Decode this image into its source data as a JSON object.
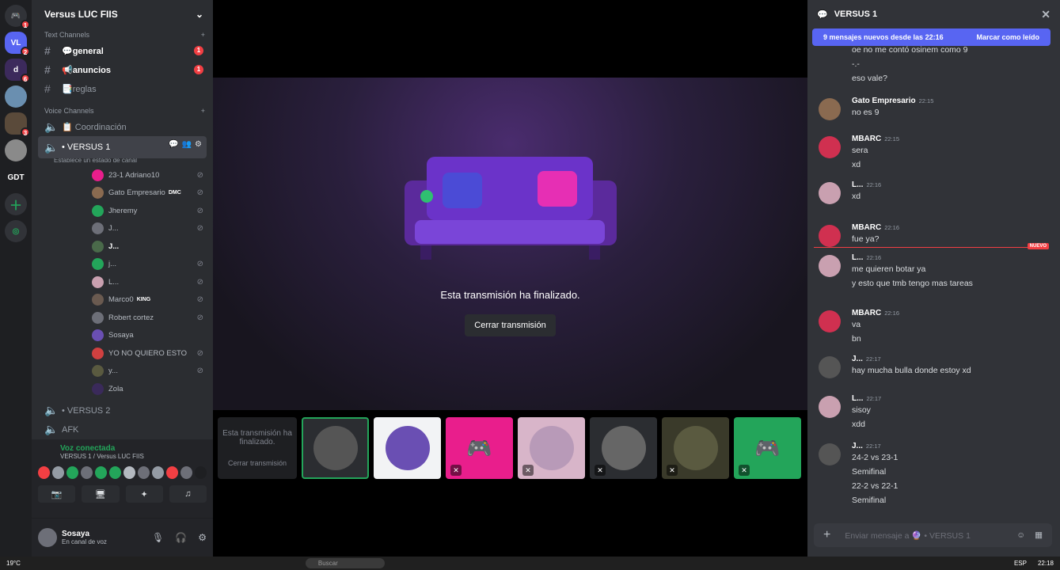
{
  "server": {
    "name": "Versus LUC FIIS"
  },
  "rail": [
    {
      "label": "",
      "badge": "1"
    },
    {
      "label": "VL",
      "badge": "2"
    },
    {
      "label": "d",
      "badge": "6"
    },
    {
      "label": "",
      "badge": ""
    },
    {
      "label": "",
      "badge": "3"
    },
    {
      "label": "",
      "badge": ""
    },
    {
      "label": "GDT",
      "badge": ""
    }
  ],
  "categories": {
    "text": "Text Channels",
    "voice": "Voice Channels"
  },
  "text_channels": [
    {
      "name": "💬general",
      "badge": "1"
    },
    {
      "name": "📢anuncios",
      "badge": "1"
    },
    {
      "name": "📑reglas",
      "badge": ""
    }
  ],
  "voice_channels": {
    "coordinacion": "📋 Coordinación",
    "active": "• VERSUS 1",
    "active_sub": "Establece un estado de canal",
    "v2": "• VERSUS 2",
    "afk": "AFK"
  },
  "voice_users": [
    {
      "name": "23-1 Adriano10",
      "tag": ""
    },
    {
      "name": "Gato Empresario",
      "tag": "DMC"
    },
    {
      "name": "Jheremy",
      "tag": ""
    },
    {
      "name": "J...",
      "tag": ""
    },
    {
      "name": "J...",
      "tag": ""
    },
    {
      "name": "j...",
      "tag": ""
    },
    {
      "name": "L...",
      "tag": ""
    },
    {
      "name": "Marco0",
      "tag": "KING"
    },
    {
      "name": "Robert cortez",
      "tag": ""
    },
    {
      "name": "Sosaya",
      "tag": ""
    },
    {
      "name": "YO NO QUIERO ESTO",
      "tag": ""
    },
    {
      "name": "y...",
      "tag": ""
    },
    {
      "name": "Zola",
      "tag": ""
    }
  ],
  "voice_panel": {
    "status": "Voz conectada",
    "sub": "VERSUS 1 / Versus LUC FIIS"
  },
  "user_panel": {
    "name": "Sosaya",
    "status": "En canal de voz"
  },
  "stream": {
    "ended": "Esta transmisión ha finalizado.",
    "close": "Cerrar transmisión",
    "tile_text": "Esta transmisión ha finalizado.",
    "tile_close": "Cerrar transmisión"
  },
  "chat": {
    "title": "VERSUS 1",
    "new_banner": "9 mensajes nuevos desde las 22:16",
    "mark_read": "Marcar como leído",
    "new_tag": "NUEVO",
    "input_placeholder": "Enviar mensaje a 🔮 • VERSUS 1",
    "top_lines": [
      "oe no me contó osinem como 9",
      "-.-",
      "eso vale?"
    ],
    "messages": [
      {
        "author": "Gato Empresario",
        "time": "22:15",
        "lines": [
          "no es 9"
        ]
      },
      {
        "author": "MBARC",
        "time": "22:15",
        "lines": [
          "sera",
          "xd"
        ]
      },
      {
        "author": "L...",
        "time": "22:16",
        "lines": [
          "xd"
        ]
      },
      {
        "author": "MBARC",
        "time": "22:16",
        "lines": [
          "fue ya?"
        ]
      },
      {
        "author": "L...",
        "time": "22:16",
        "lines": [
          "me quieren botar ya",
          "y esto que tmb tengo mas tareas"
        ]
      },
      {
        "author": "MBARC",
        "time": "22:16",
        "lines": [
          "va",
          "bn"
        ]
      },
      {
        "author": "J...",
        "time": "22:17",
        "lines": [
          "hay mucha bulla donde estoy xd"
        ]
      },
      {
        "author": "L...",
        "time": "22:17",
        "lines": [
          "sisoy",
          "xdd"
        ]
      },
      {
        "author": "J...",
        "time": "22:17",
        "lines": [
          "24-2 vs 23-1",
          "Semifinal",
          "22-2 vs 22-1",
          "Semifinal"
        ]
      }
    ]
  },
  "taskbar": {
    "temp": "19°C",
    "search": "Buscar",
    "lang": "ESP",
    "clock": "22:18"
  },
  "colors": {
    "accent": "#5865f2",
    "danger": "#f23f43",
    "online": "#23a55a"
  }
}
